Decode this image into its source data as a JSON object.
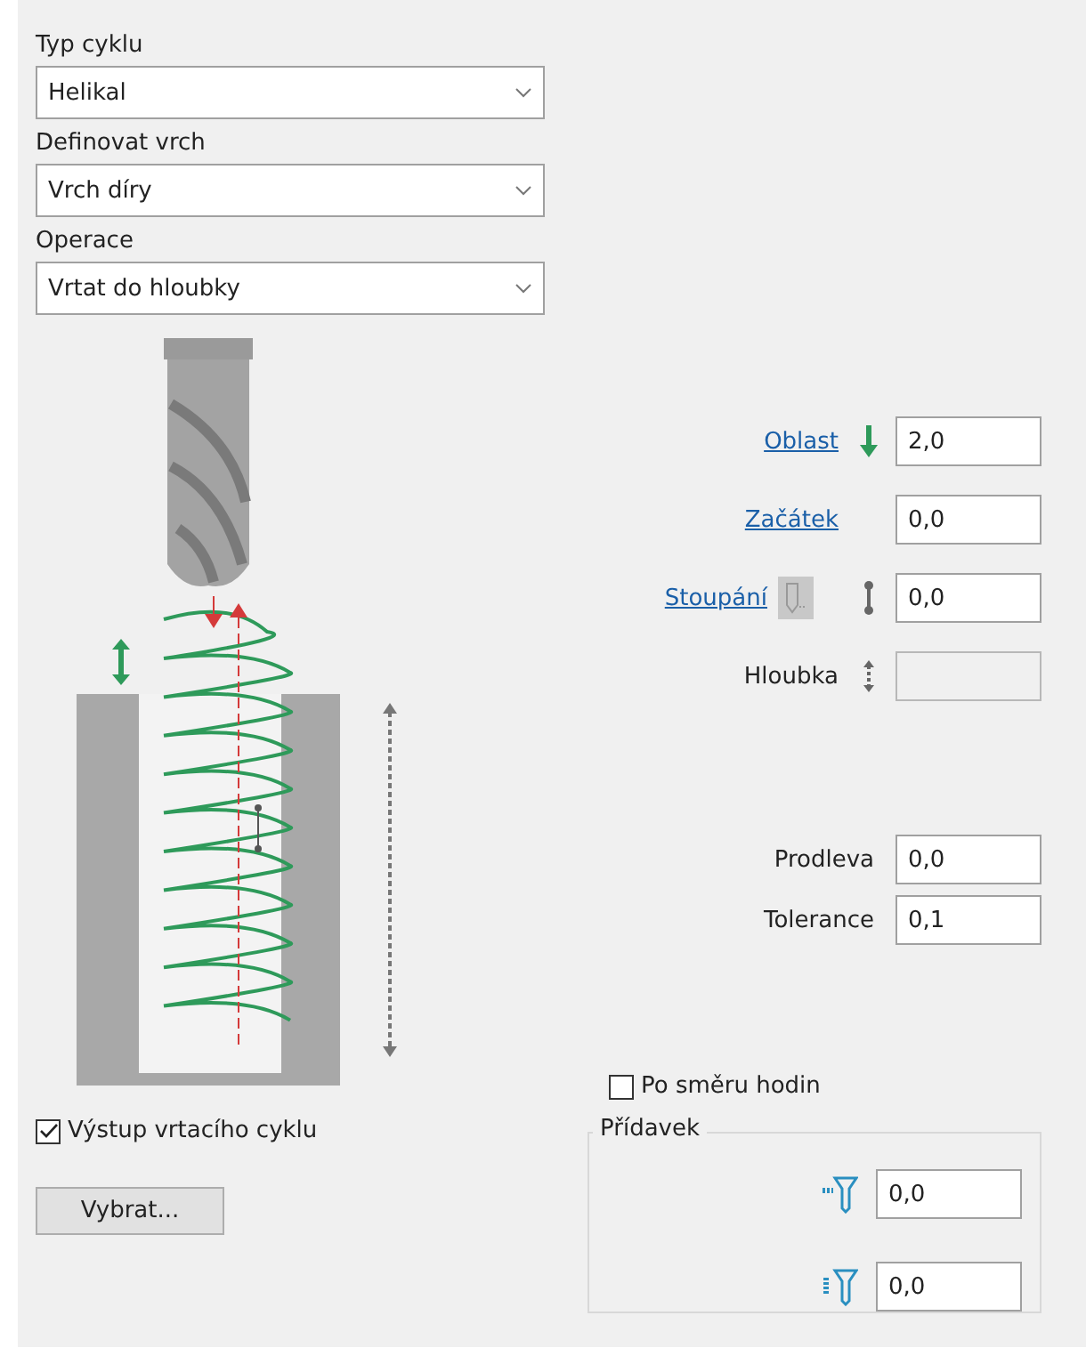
{
  "dropdowns": [
    {
      "label": "Typ cyklu",
      "value": "Helikal"
    },
    {
      "label": "Definovat vrch",
      "value": "Vrch díry"
    },
    {
      "label": "Operace",
      "value": "Vrtat do hloubky"
    }
  ],
  "parameters": [
    {
      "label": "Oblast",
      "link": true,
      "value": "2,0",
      "disabled": false
    },
    {
      "label": "Začátek",
      "link": true,
      "value": "0,0",
      "disabled": false
    },
    {
      "label": "Stoupání",
      "link": true,
      "value": "0,0",
      "disabled": false
    },
    {
      "label": "Hloubka",
      "link": false,
      "disabled": true
    }
  ],
  "timing": [
    {
      "label": "Prodleva",
      "value": "0,0"
    },
    {
      "label": "Tolerance",
      "value": "0,1"
    }
  ],
  "clockwise": {
    "label": "Po směru hodin",
    "checked": false
  },
  "allowance": {
    "title": "Přídavek",
    "fields": [
      {
        "value": "0,0"
      },
      {
        "value": "0,0"
      }
    ]
  },
  "output_cycle": {
    "label": "Výstup vrtacího cyklu",
    "checked": true
  },
  "select_button": "Vybrat..."
}
